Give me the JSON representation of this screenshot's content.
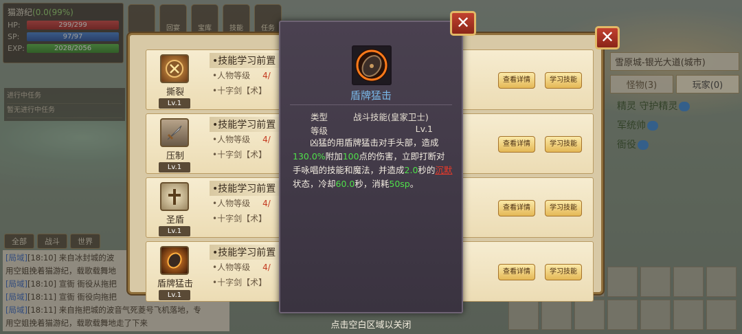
{
  "player": {
    "name": "猫游纪",
    "tag": "(0.0(99%)",
    "hp_label": "HP:",
    "hp": "299/299",
    "hp_fill": 1.0,
    "sp_label": "SP:",
    "sp": "97/97",
    "sp_fill": 1.0,
    "exp_label": "EXP:",
    "exp": "2028/2056",
    "exp_fill": 0.986
  },
  "top_icons": [
    "",
    "回宴",
    "宝库",
    "技能",
    "任务",
    "",
    "",
    "",
    ""
  ],
  "tasks": [
    "进行中任务",
    "暂无进行中任务"
  ],
  "chat": {
    "tabs": [
      "全部",
      "战斗",
      "世界"
    ],
    "lines": [
      {
        "channel": "[局域]",
        "time": "[18:10]",
        "text": " 来自冰封城的波"
      },
      {
        "channel": "",
        "time": "",
        "text": "用空姐挽着猫游纪，载歌载舞地"
      },
      {
        "channel": "[局域]",
        "time": "[18:10]",
        "text": " 宣衙 衙役从拖把"
      },
      {
        "channel": "[局域]",
        "time": "[18:11]",
        "text": " 宣衙 衙役向拖把"
      },
      {
        "channel": "[局域]",
        "time": "[18:11]",
        "text": " 来自拖把城的波音气死菱号飞机落地，专"
      },
      {
        "channel": "",
        "time": "",
        "text": "用空姐挽着猫游纪，载歌载舞地走了下来"
      }
    ]
  },
  "right": {
    "location": "雪原城-银光大道(城市)",
    "tabs": [
      "怪物(3)",
      "玩家(0)"
    ],
    "npcs": [
      "精灵 守护精灵",
      "军统帅",
      "衙役"
    ]
  },
  "skills": [
    {
      "name": "撕裂",
      "level": "Lv.1",
      "req_title": "•技能学习前置",
      "req1": "•人物等级",
      "req1_val": "4/",
      "req2": "•十字剑【术】",
      "detail": "查看详情",
      "learn": "学习技能",
      "icon": "tear-icon"
    },
    {
      "name": "压制",
      "level": "Lv.1",
      "req_title": "•技能学习前置",
      "req1": "•人物等级",
      "req1_val": "4/",
      "req2": "•十字剑【术】",
      "detail": "查看详情",
      "learn": "学习技能",
      "icon": "sword-icon"
    },
    {
      "name": "圣盾",
      "level": "Lv.1",
      "req_title": "•技能学习前置",
      "req1": "•人物等级",
      "req1_val": "4/",
      "req2": "•十字剑【术】",
      "detail": "查看详情",
      "learn": "学习技能",
      "icon": "cross-shield-icon"
    },
    {
      "name": "盾牌猛击",
      "level": "Lv.1",
      "req_title": "•技能学习前置",
      "req1": "•人物等级",
      "req1_val": "4/",
      "req2": "•十字剑【术】",
      "detail": "查看详情",
      "learn": "学习技能",
      "icon": "shield-bash-icon"
    }
  ],
  "tooltip": {
    "title": "盾牌猛击",
    "type_label": "类型",
    "type_value": "战斗技能(皇家卫士)",
    "level_label": "等级",
    "level_value": "Lv.1",
    "desc_1": "凶猛的用盾牌猛击对手头部，造成",
    "dmg_pct": "130.0%",
    "desc_2": "附加",
    "dmg_flat": "100",
    "desc_3": "点的伤害，立即打断对手咏唱的技能和魔法，并造成",
    "stun_sec": "2.0",
    "desc_4": "秒的",
    "status_word": "沉默",
    "desc_5": "状态，冷却",
    "cooldown": "60.0",
    "desc_6": "秒，消耗",
    "sp_cost": "50sp",
    "desc_7": "。"
  },
  "close_hint": "点击空白区域以关闭",
  "colors": {
    "highlight_green": "#4fe04a",
    "status_red": "#e83a2a",
    "title_blue": "#79b8e8"
  }
}
